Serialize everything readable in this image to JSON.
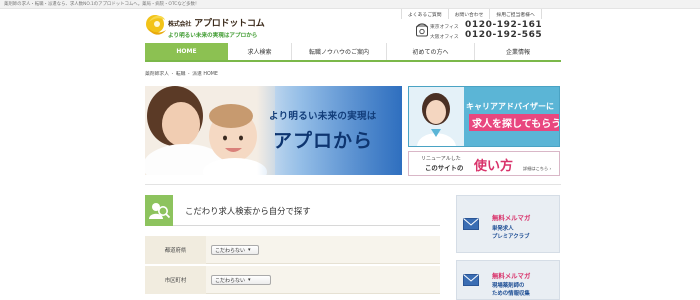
{
  "topbar": {
    "text": "薬剤師の求人・転職・派遣なら、求人数NO.1のアプロドットコムへ。薬局・病院・OTCなど多数！"
  },
  "logo": {
    "prefix": "株式会社",
    "name": "アプロドットコム",
    "tagline": "より明るい未来の実現はアプロから"
  },
  "header_links": [
    "よくあるご質問",
    "お問い合わせ",
    "採用ご担当者様へ"
  ],
  "phones": [
    {
      "office": "東京オフィス",
      "number": "0120-192-161"
    },
    {
      "office": "大阪オフィス",
      "number": "0120-192-565"
    }
  ],
  "nav": [
    "HOME",
    "求人検索",
    "転職ノウハウのご案内",
    "初めての方へ",
    "企業情報"
  ],
  "breadcrumb": [
    "薬剤師求人",
    "転職",
    "派遣 HOME"
  ],
  "hero": {
    "line1": "より明るい未来の実現は",
    "line2": "アプロから"
  },
  "side_advisor": {
    "line1": "キャリアアドバイザーに",
    "line2": "求人を探してもらう"
  },
  "side_howto": {
    "small1": "リニューアルした",
    "small2": "このサイトの",
    "big": "使い方",
    "detail": "詳細はこちら ›"
  },
  "search": {
    "title": "こだわり求人検索から自分で探す",
    "rows": [
      {
        "label": "都道府県",
        "value": "こだわらない"
      },
      {
        "label": "市区町村",
        "value": "こだわらない"
      }
    ]
  },
  "banners": [
    {
      "tag": "無料メルマガ",
      "line1": "単発求人",
      "line2": "プレミアクラブ"
    },
    {
      "tag": "無料メルマガ",
      "line1": "現場薬剤師の",
      "line2": "ための情報収集"
    }
  ],
  "colors": {
    "nav_active": "#8cc152",
    "brand_green": "#3c9a2d",
    "accent_pink": "#d9336b",
    "advisor_blue": "#5bb5d6",
    "banner_blue": "#1f4f95"
  }
}
